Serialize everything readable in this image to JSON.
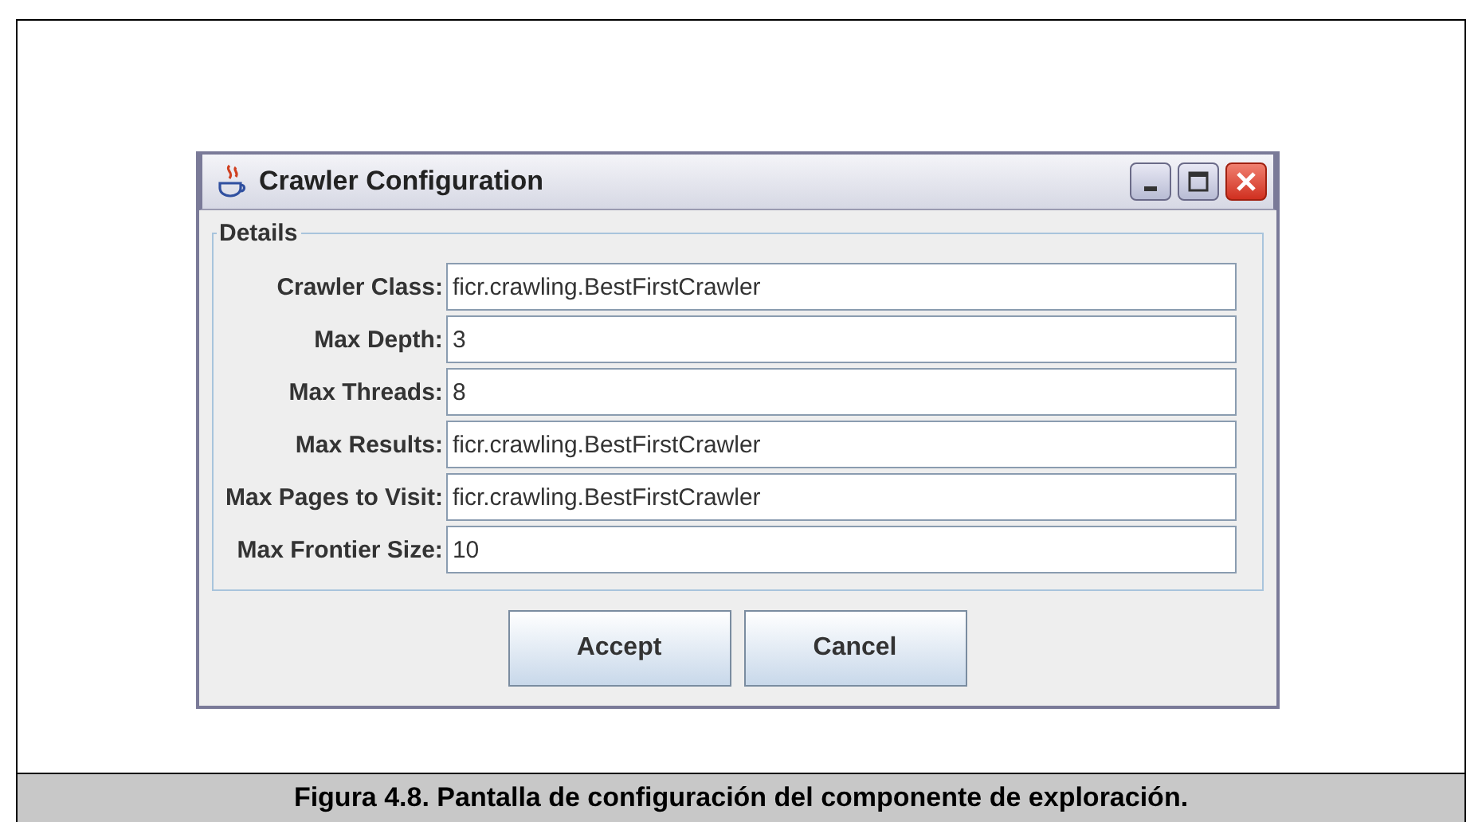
{
  "window": {
    "title": "Crawler Configuration"
  },
  "group": {
    "title": "Details"
  },
  "fields": [
    {
      "label": "Crawler Class:",
      "value": "ficr.crawling.BestFirstCrawler"
    },
    {
      "label": "Max Depth:",
      "value": "3"
    },
    {
      "label": "Max Threads:",
      "value": "8"
    },
    {
      "label": "Max Results:",
      "value": "ficr.crawling.BestFirstCrawler"
    },
    {
      "label": "Max Pages to Visit:",
      "value": "ficr.crawling.BestFirstCrawler"
    },
    {
      "label": "Max Frontier Size:",
      "value": "10"
    }
  ],
  "buttons": [
    "Accept",
    "Cancel"
  ],
  "caption": "Figura 4.8. Pantalla de configuración del componente de exploración."
}
